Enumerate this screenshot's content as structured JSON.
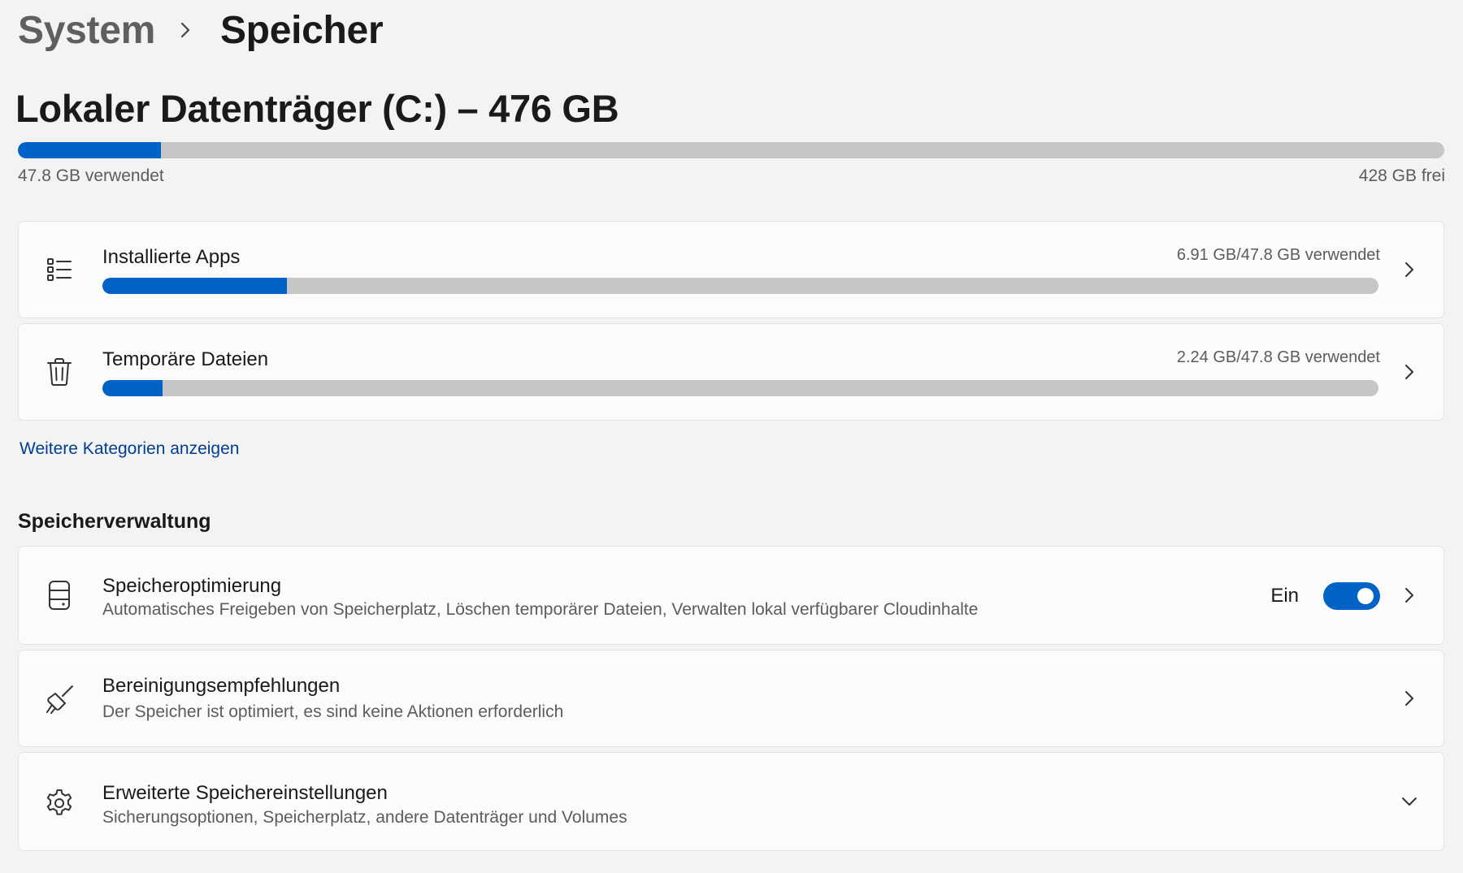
{
  "breadcrumb": {
    "parent": "System",
    "current": "Speicher"
  },
  "drive": {
    "title": "Lokaler Datenträger (C:) – 476 GB",
    "used_label": "47.8 GB verwendet",
    "free_label": "428 GB frei",
    "used_fraction": 0.1
  },
  "categories": [
    {
      "label": "Installierte Apps",
      "usage": "6.91 GB/47.8 GB verwendet",
      "fraction": 0.1446,
      "icon": "list-icon"
    },
    {
      "label": "Temporäre Dateien",
      "usage": "2.24 GB/47.8 GB verwendet",
      "fraction": 0.0469,
      "icon": "trash-icon"
    }
  ],
  "more_categories_link": "Weitere Kategorien anzeigen",
  "management": {
    "heading": "Speicherverwaltung",
    "items": [
      {
        "title": "Speicheroptimierung",
        "subtitle": "Automatisches Freigeben von Speicherplatz, Löschen temporärer Dateien, Verwalten lokal verfügbarer Cloudinhalte",
        "icon": "storage-drive-icon",
        "toggle_label": "Ein",
        "toggle_on": true
      },
      {
        "title": "Bereinigungsempfehlungen",
        "subtitle": "Der Speicher ist optimiert, es sind keine Aktionen erforderlich",
        "icon": "broom-icon"
      },
      {
        "title": "Erweiterte Speichereinstellungen",
        "subtitle": "Sicherungsoptionen, Speicherplatz, andere Datenträger und Volumes",
        "icon": "gear-icon"
      }
    ]
  },
  "colors": {
    "accent": "#0063c5",
    "track": "#c6c6c6",
    "link": "#003e92",
    "background": "#f3f3f3",
    "card": "#fbfbfb"
  }
}
